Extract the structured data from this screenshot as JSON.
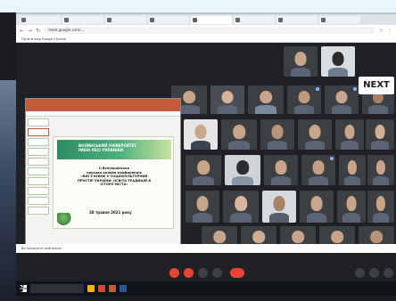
{
  "browser": {
    "tabs": [
      {
        "label": "",
        "active": false
      },
      {
        "label": "",
        "active": false
      },
      {
        "label": "",
        "active": false
      },
      {
        "label": "",
        "active": false
      },
      {
        "label": "",
        "active": true
      },
      {
        "label": "",
        "active": false
      },
      {
        "label": "",
        "active": false
      },
      {
        "label": "",
        "active": false
      }
    ],
    "url": "meet.google.com/...",
    "bookmark_bar": "Почати ваш Google Chrome"
  },
  "meet": {
    "notice": "",
    "next_label": "NEXT",
    "presentation": {
      "banner_title": "ВОЛИНСЬКИЙ УНІВЕРСИТЕТ\nІМЕНІ ЛЕСІ УКРАЇНКИ",
      "slide_text": "II Всеукраїнська\nнаукова онлайн-конференція\n«ВИЇ З КНИЖ У СОЦІОКУЛЬТУРНИЙ\nПРОСТІР УКРАЇНИ: ОСВІТА ТРАДИЦІЙ В\nІСТОРІЇ МІСТА»",
      "date": "28 травня 2021 року"
    },
    "share_bar": "Ви показуєте свій екран",
    "avatar_letter": "A",
    "avatar_color": "#e8710a"
  },
  "taskbar": {
    "search_placeholder": "",
    "clock": ""
  },
  "colors": {
    "meet_bg": "#202124",
    "tile_bg": "#3c4043",
    "end_call": "#ea4335",
    "ppt_ribbon": "#c55a3b"
  }
}
